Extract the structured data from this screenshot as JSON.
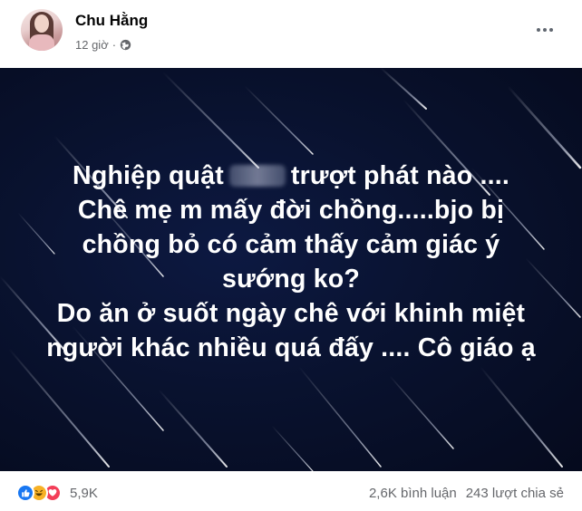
{
  "post": {
    "author": "Chu Hằng",
    "time": "12 giờ",
    "separator": "·",
    "privacy_icon": "globe-icon",
    "more_icon": "more-horizontal-icon"
  },
  "image_text": {
    "lines": [
      "Nghiệp quật",
      "trượt phát nào ....",
      "Chê mẹ m mấy đời chồng.....bjo bị",
      "chồng bỏ có cảm thấy cảm giác ý",
      "sướng ko?",
      "Do ăn ở suốt ngày chê với khinh miệt",
      "người khác nhiều quá đấy .... Cô giáo ạ"
    ]
  },
  "footer": {
    "reaction_icons": [
      "like-icon",
      "haha-icon",
      "love-icon"
    ],
    "reaction_count": "5,9K",
    "comments": "2,6K bình luận",
    "shares": "243 lượt chia sẻ"
  },
  "colors": {
    "name": "#050505",
    "meta": "#65676b",
    "like": "#1877f2",
    "haha": "#f7b125",
    "love": "#f33e58",
    "image_bg": "#09122f"
  }
}
